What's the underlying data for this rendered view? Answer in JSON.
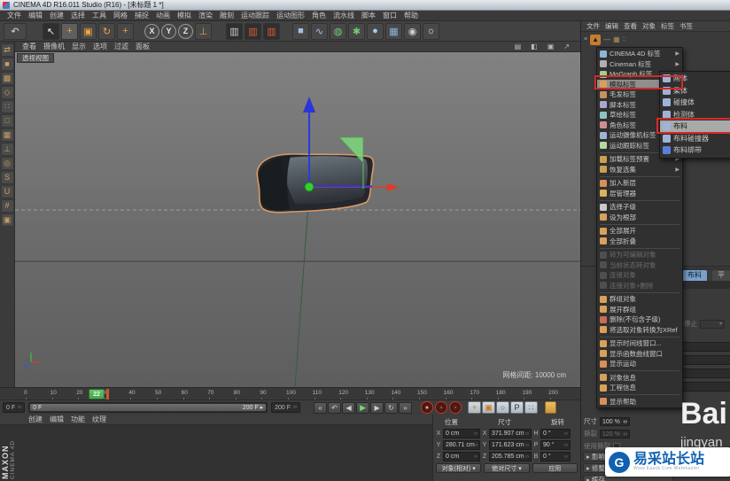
{
  "window": {
    "title": "CINEMA 4D R16.011 Studio (R16) - [未标题 1 *]"
  },
  "menubar": {
    "items": [
      "文件",
      "编辑",
      "创建",
      "选择",
      "工具",
      "网格",
      "捕捉",
      "动画",
      "模拟",
      "渲染",
      "雕刻",
      "运动跟踪",
      "运动图形",
      "角色",
      "流水线",
      "脚本",
      "窗口",
      "帮助"
    ]
  },
  "toolbar": {
    "buttons": [
      {
        "name": "undo-icon",
        "glyph": "↶",
        "fg": "#d8d8d8",
        "w": 26
      },
      {
        "name": "sp",
        "spacer": 14
      },
      {
        "name": "live-selection-icon",
        "glyph": "↖",
        "fg": "#eeeeee",
        "bg": "#2f2f2f"
      },
      {
        "name": "move-tool-icon",
        "glyph": "+",
        "fg": "#e8a33d",
        "bg": "#5f5f5f"
      },
      {
        "name": "scale-tool-icon",
        "glyph": "▣",
        "fg": "#e8a33d"
      },
      {
        "name": "rotate-tool-icon",
        "glyph": "↻",
        "fg": "#e8a33d"
      },
      {
        "name": "last-tool-icon",
        "glyph": "+",
        "fg": "#e8a33d"
      },
      {
        "name": "sp",
        "spacer": 8
      },
      {
        "name": "x-axis-lock-icon",
        "glyph": "X",
        "circle": true,
        "fg": "#e6e6e6"
      },
      {
        "name": "y-axis-lock-icon",
        "glyph": "Y",
        "circle": true,
        "fg": "#e6e6e6"
      },
      {
        "name": "z-axis-lock-icon",
        "glyph": "Z",
        "circle": true,
        "fg": "#e6e6e6"
      },
      {
        "name": "coord-system-icon",
        "glyph": "⊥",
        "fg": "#e8a33d"
      },
      {
        "name": "sp",
        "spacer": 12
      },
      {
        "name": "render-view-icon",
        "glyph": "▥",
        "fg": "#cccccc",
        "bg": "#2f2f2f"
      },
      {
        "name": "render-picture-viewer-icon",
        "glyph": "▥",
        "fg": "#e05a3a",
        "bg": "#2f2f2f"
      },
      {
        "name": "render-settings-icon",
        "glyph": "▥",
        "fg": "#e05a3a",
        "bg": "#2f2f2f"
      },
      {
        "name": "sp",
        "spacer": 10
      },
      {
        "name": "add-cube-icon",
        "glyph": "■",
        "fg": "#9fc3e8"
      },
      {
        "name": "spline-pen-icon",
        "glyph": "∿",
        "fg": "#9fc3e8"
      },
      {
        "name": "subdivision-surface-icon",
        "glyph": "◍",
        "fg": "#6fce6f"
      },
      {
        "name": "modeling-objects-icon",
        "glyph": "✱",
        "fg": "#6fce6f"
      },
      {
        "name": "deformer-icon",
        "glyph": "●",
        "fg": "#a9c9e9"
      },
      {
        "name": "environment-icon",
        "glyph": "▦",
        "fg": "#8fb3d9"
      },
      {
        "name": "camera-icon",
        "glyph": "◉",
        "fg": "#cfcfcf"
      },
      {
        "name": "light-icon",
        "glyph": "☼",
        "fg": "#efe6b4"
      }
    ]
  },
  "left_toolbar": {
    "tools": [
      {
        "name": "make-editable-icon",
        "glyph": "⇄"
      },
      {
        "name": "model-mode-icon",
        "glyph": "■"
      },
      {
        "name": "texture-mode-icon",
        "glyph": "▩"
      },
      {
        "name": "workplane-mode-icon",
        "glyph": "◇"
      },
      {
        "name": "points-mode-icon",
        "glyph": "∷"
      },
      {
        "name": "edges-mode-icon",
        "glyph": "□"
      },
      {
        "name": "polygons-mode-icon",
        "glyph": "▦"
      },
      {
        "name": "enable-axis-icon",
        "glyph": "⊥"
      },
      {
        "name": "viewport-solo-icon",
        "glyph": "◎"
      },
      {
        "name": "keyframe-selection-icon",
        "glyph": "S"
      },
      {
        "name": "enable-snap-icon",
        "glyph": "U"
      },
      {
        "name": "grid-snap-icon",
        "glyph": "#"
      },
      {
        "name": "workplane-lock-icon",
        "glyph": "▣"
      }
    ]
  },
  "viewport": {
    "menus": [
      "查看",
      "摄像机",
      "显示",
      "选项",
      "过滤",
      "面板"
    ],
    "corner_icons": [
      "▤",
      "◧",
      "▣",
      "↗"
    ],
    "label": "透视视图",
    "grid_text": "网格间距: 10000 cm"
  },
  "right_panel": {
    "object_manager": {
      "menus": [
        "文件",
        "编辑",
        "查看",
        "对象",
        "标签",
        "书签"
      ]
    },
    "attribute_manager": {
      "tabs": [
        "布料",
        "平滑"
      ],
      "stop_label": "停止",
      "fields": [
        {
          "label": "尺寸",
          "value": "100 %",
          "gray": false
        },
        {
          "label": "撕裂",
          "value": "120 %",
          "gray": true
        },
        {
          "label": "使用撕裂",
          "value": "",
          "gray": true,
          "check": true
        }
      ],
      "sections": [
        "影响",
        "修整",
        "缓存"
      ]
    },
    "context_menu": {
      "items": [
        {
          "label": "CINEMA 4D 标签",
          "sub": true,
          "icon": "#8fb3d9"
        },
        {
          "label": "Cineman 标签",
          "sub": true,
          "icon": "#b0b0b0"
        },
        {
          "label": "MoGraph 标签",
          "sub": true,
          "icon": "#9fd08f"
        },
        {
          "label": "模拟标签",
          "sub": true,
          "hl": true,
          "red": true,
          "icon": "#d9a05a"
        },
        {
          "label": "毛发标签",
          "sub": true,
          "icon": "#c7925e"
        },
        {
          "label": "脚本标签",
          "sub": true,
          "icon": "#a8a8d0"
        },
        {
          "label": "草绘标签",
          "sub": true,
          "icon": "#8fc3c3"
        },
        {
          "label": "角色标签",
          "sub": true,
          "icon": "#d08f8f"
        },
        {
          "label": "运动摄像机标签",
          "sub": true,
          "icon": "#9fb3d9"
        },
        {
          "label": "运动跟踪标签",
          "sub": true,
          "icon": "#b3d99f"
        },
        {
          "sep": true
        },
        {
          "label": "加载标签预置",
          "sub": true,
          "icon": "#caa24f"
        },
        {
          "label": "恢复选集",
          "sub": true,
          "icon": "#caa24f"
        },
        {
          "sep": true
        },
        {
          "label": "加入新层",
          "icon": "#d98f5a"
        },
        {
          "label": "层管理器",
          "icon": "#d9b45a"
        },
        {
          "sep": true
        },
        {
          "label": "选择子级",
          "icon": "#c9c9c9"
        },
        {
          "label": "设为根部",
          "icon": "#d9a05a"
        },
        {
          "sep": true
        },
        {
          "label": "全部展开",
          "icon": "#d9a05a"
        },
        {
          "label": "全部折叠",
          "icon": "#d9a05a"
        },
        {
          "sep": true
        },
        {
          "label": "转为可编辑对象",
          "gray": true,
          "icon": "#8a8a8a"
        },
        {
          "label": "当前状态转对象",
          "gray": true,
          "icon": "#8a8a8a"
        },
        {
          "label": "连接对象",
          "gray": true,
          "icon": "#8a8a8a"
        },
        {
          "label": "连接对象+删除",
          "gray": true,
          "icon": "#8a8a8a"
        },
        {
          "sep": true
        },
        {
          "label": "群组对象",
          "icon": "#d9a05a"
        },
        {
          "label": "展开群组",
          "icon": "#d9a05a"
        },
        {
          "label": "删除(不包含子级)",
          "icon": "#c96a5a"
        },
        {
          "label": "将选取对象转换为XRef",
          "icon": "#d9a05a"
        },
        {
          "sep": true
        },
        {
          "label": "显示时间线窗口...",
          "icon": "#d9a05a"
        },
        {
          "label": "显示函数曲线窗口",
          "icon": "#d9a05a"
        },
        {
          "label": "显示运动",
          "icon": "#d98f5a"
        },
        {
          "sep": true
        },
        {
          "label": "对象信息",
          "icon": "#d9a05a"
        },
        {
          "label": "工程信息",
          "icon": "#d9a05a"
        },
        {
          "sep": true
        },
        {
          "label": "显示帮助",
          "icon": "#d98f5a"
        }
      ]
    },
    "submenu": {
      "items": [
        {
          "label": "刚体",
          "icon": "#9fb3d9"
        },
        {
          "label": "柔体",
          "icon": "#9fb3d9"
        },
        {
          "label": "碰撞体",
          "icon": "#9fb3d9"
        },
        {
          "label": "检测体",
          "icon": "#9fb3d9"
        },
        {
          "label": "布料",
          "icon": "#9fb3d9",
          "hl": true,
          "red": true
        },
        {
          "label": "布料碰撞器",
          "icon": "#9fb3d9"
        },
        {
          "label": "布料绑带",
          "icon": "#5a7fd9"
        }
      ]
    }
  },
  "timeline": {
    "ticks": [
      0,
      10,
      20,
      30,
      40,
      50,
      60,
      70,
      80,
      90,
      100,
      110,
      120,
      130,
      140,
      150,
      160,
      170,
      180,
      190,
      200
    ],
    "playhead": "22",
    "range_start": "0 F",
    "range_end": "200 F",
    "slider_left": "0 F",
    "slider_right": "200 F ▸"
  },
  "transport": {
    "buttons": [
      {
        "name": "go-to-start-button",
        "glyph": "«"
      },
      {
        "name": "play-backwards-button",
        "glyph": "↶"
      },
      {
        "name": "previous-frame-button",
        "glyph": "◀"
      },
      {
        "name": "play-forward-button",
        "glyph": "▶",
        "green": true
      },
      {
        "name": "next-frame-button",
        "glyph": "▶"
      },
      {
        "name": "loop-button",
        "glyph": "↻"
      },
      {
        "name": "go-to-end-button",
        "glyph": "»"
      }
    ],
    "record": [
      {
        "name": "record-keyframe-button",
        "glyph": "●"
      },
      {
        "name": "autokey-button",
        "glyph": "◦"
      },
      {
        "name": "record-options-button",
        "glyph": "◦"
      }
    ],
    "keys": [
      {
        "name": "key-position-toggle",
        "glyph": "+",
        "fg": "#d07818"
      },
      {
        "name": "key-scale-toggle",
        "glyph": "▣",
        "fg": "#d07818"
      },
      {
        "name": "key-rotation-toggle",
        "glyph": "○",
        "fg": "#555555"
      },
      {
        "name": "key-parameter-toggle",
        "glyph": "P",
        "fg": "#333333"
      },
      {
        "name": "key-pla-toggle",
        "glyph": "∷",
        "fg": "#4a6a8a"
      }
    ]
  },
  "materials": {
    "menus": [
      "创建",
      "编辑",
      "功能",
      "纹理"
    ]
  },
  "brand": {
    "maxon": "MAXON",
    "cinema": "CINEMA 4D"
  },
  "coordinates": {
    "headers": [
      "位置",
      "尺寸",
      "旋转"
    ],
    "rows": [
      {
        "l1": "X",
        "v1": "0 cm",
        "l2": "X",
        "v2": "371.907 cm",
        "l3": "H",
        "v3": "0 °"
      },
      {
        "l1": "Y",
        "v1": "280.71 cm",
        "l2": "Y",
        "v2": "171.623 cm",
        "l3": "P",
        "v3": "90 °"
      },
      {
        "l1": "Z",
        "v1": "0 cm",
        "l2": "Z",
        "v2": "205.785 cm",
        "l3": "B",
        "v3": "0 °"
      }
    ],
    "footer": [
      {
        "label": "对象(相对)",
        "arrow": true
      },
      {
        "label": "绝对尺寸",
        "arrow": true
      },
      {
        "label": "应用",
        "arrow": false
      }
    ]
  },
  "watermarks": {
    "bai": "Bai",
    "jingyan": "jingyan",
    "site": "易采站长站",
    "site_sub": "Www.Easck.Com Webmaster",
    "logo_glyph": "G"
  }
}
